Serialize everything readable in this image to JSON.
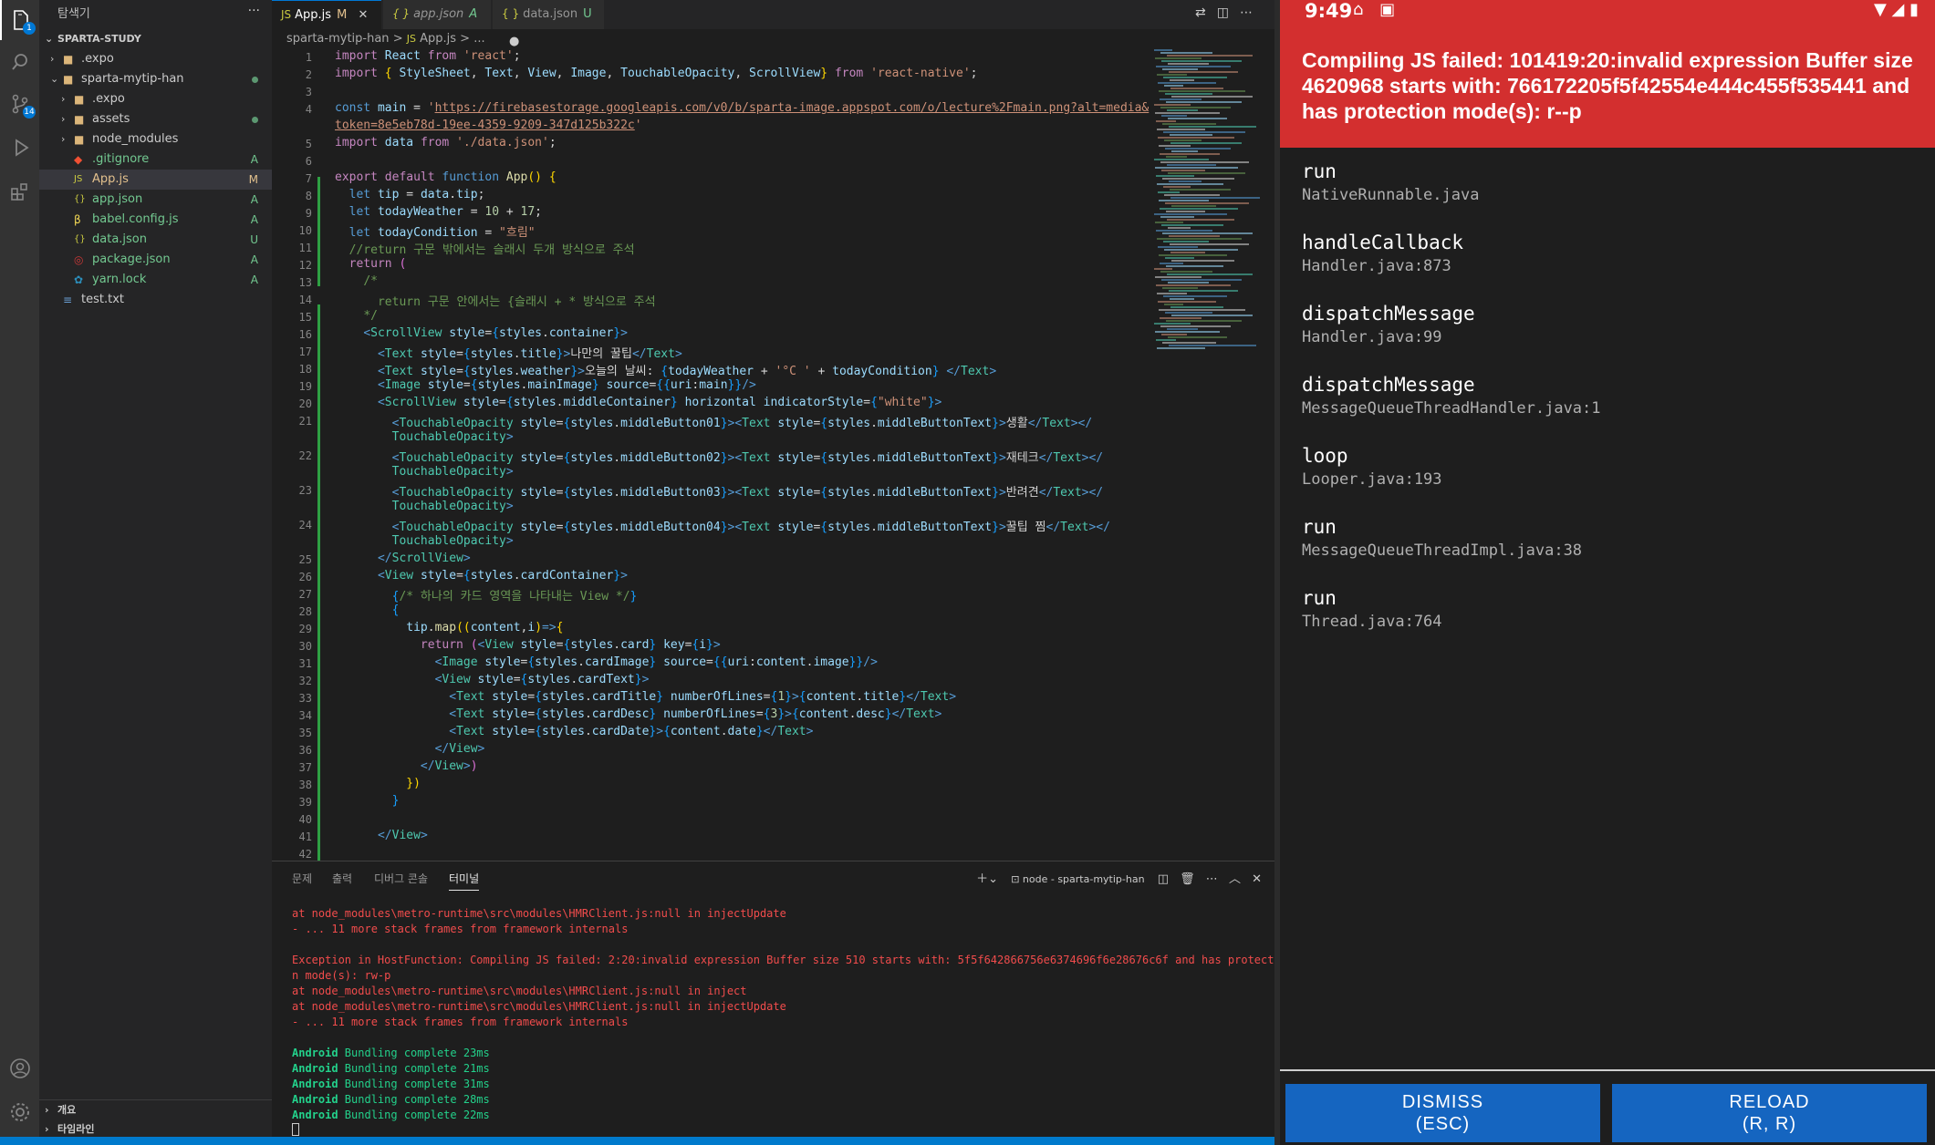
{
  "vscode": {
    "activity_badges": {
      "explorer": "1",
      "scm": "14"
    },
    "sidebar": {
      "title": "탐색기",
      "more": "···",
      "workspace": "SPARTA-STUDY",
      "items": [
        {
          "label": ".expo",
          "icon": "folder",
          "status": ""
        },
        {
          "label": "sparta-mytip-han",
          "icon": "folder",
          "status": "dot"
        },
        {
          "label": ".expo",
          "icon": "folder",
          "status": ""
        },
        {
          "label": "assets",
          "icon": "folder",
          "status": "dot"
        },
        {
          "label": "node_modules",
          "icon": "folder",
          "status": ""
        },
        {
          "label": ".gitignore",
          "icon": "git",
          "status": "A"
        },
        {
          "label": "App.js",
          "icon": "js",
          "status": "M"
        },
        {
          "label": "app.json",
          "icon": "json",
          "status": "A"
        },
        {
          "label": "babel.config.js",
          "icon": "babel",
          "status": "A"
        },
        {
          "label": "data.json",
          "icon": "json",
          "status": "U"
        },
        {
          "label": "package.json",
          "icon": "npm",
          "status": "A"
        },
        {
          "label": "yarn.lock",
          "icon": "yarn",
          "status": "A"
        },
        {
          "label": "test.txt",
          "icon": "txt",
          "status": ""
        }
      ],
      "outline": "개요",
      "timeline": "타임라인"
    },
    "tabs": [
      {
        "icon": "JS",
        "label": "App.js",
        "status": "M",
        "close": "✕"
      },
      {
        "icon": "{ }",
        "label": "app.json",
        "status": "A",
        "close": ""
      },
      {
        "icon": "{ }",
        "label": "data.json",
        "status": "U",
        "close": "●"
      }
    ],
    "breadcrumb": {
      "folder": "sparta-mytip-han",
      "sep": ">",
      "file": "App.js",
      "tail": "> ..."
    },
    "panel": {
      "tabs": [
        "문제",
        "출력",
        "디버그 콘솔",
        "터미널"
      ],
      "terminal_name": "node - sparta-mytip-han",
      "lines": [
        {
          "text": "at node_modules\\metro-runtime\\src\\modules\\HMRClient.js:null in injectUpdate",
          "color": "red"
        },
        {
          "text": "- ... 11 more stack frames from framework internals",
          "color": "red"
        },
        {
          "text": "",
          "color": ""
        },
        {
          "text": "Exception in HostFunction: Compiling JS failed: 2:20:invalid expression Buffer size 510 starts with: 5f5f642866756e6374696f6e28676c6f and has protectio",
          "color": "red"
        },
        {
          "text": "n mode(s): rw-p",
          "color": "red"
        },
        {
          "text": "at node_modules\\metro-runtime\\src\\modules\\HMRClient.js:null in inject",
          "color": "red"
        },
        {
          "text": "at node_modules\\metro-runtime\\src\\modules\\HMRClient.js:null in injectUpdate",
          "color": "red"
        },
        {
          "text": "- ... 11 more stack frames from framework internals",
          "color": "red"
        },
        {
          "text": "",
          "color": ""
        },
        {
          "text": "Android Bundling complete 23ms",
          "color": "green"
        },
        {
          "text": "Android Bundling complete 21ms",
          "color": "green"
        },
        {
          "text": "Android Bundling complete 31ms",
          "color": "green"
        },
        {
          "text": "Android Bundling complete 28ms",
          "color": "green"
        },
        {
          "text": "Android Bundling complete 22ms",
          "color": "green"
        }
      ]
    }
  },
  "android": {
    "time": "9:49",
    "error_message": "Compiling JS failed: 101419:20:invalid expression Buffer size 4620968 starts with: 766172205f5f42554e444c455f535441 and has protection mode(s): r--p",
    "stack": [
      {
        "method": "run",
        "file": "NativeRunnable.java"
      },
      {
        "method": "handleCallback",
        "file": "Handler.java:873"
      },
      {
        "method": "dispatchMessage",
        "file": "Handler.java:99"
      },
      {
        "method": "dispatchMessage",
        "file": "MessageQueueThreadHandler.java:1"
      },
      {
        "method": "loop",
        "file": "Looper.java:193"
      },
      {
        "method": "run",
        "file": "MessageQueueThreadImpl.java:38"
      },
      {
        "method": "run",
        "file": "Thread.java:764"
      }
    ],
    "dismiss_label": "DISMISS\n(ESC)",
    "reload_label": "RELOAD\n(R, R)"
  },
  "colors": {
    "accent": "#007acc",
    "error_red": "#d32f2f",
    "button_blue": "#1565c0",
    "modified": "#e2c08d",
    "added": "#73c991"
  }
}
